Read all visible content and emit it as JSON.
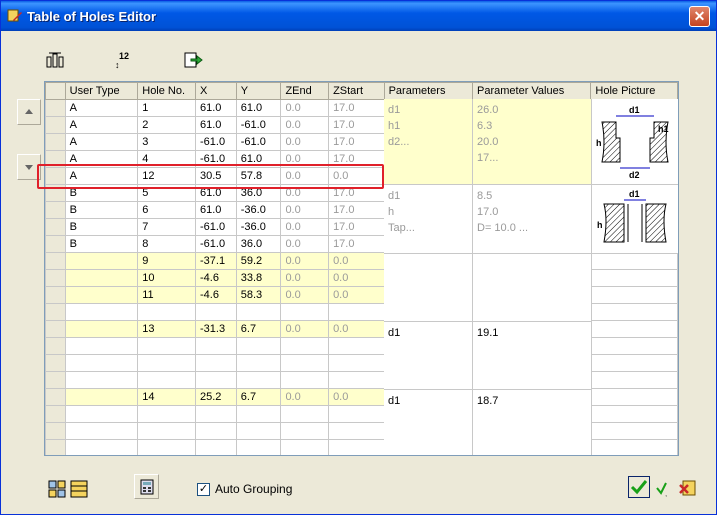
{
  "window": {
    "title": "Table of Holes Editor"
  },
  "toolbar": {
    "buttons": [
      "group-icon",
      "sort-numeric-icon",
      "export-icon"
    ]
  },
  "columns": [
    "User Type",
    "Hole No.",
    "X",
    "Y",
    "ZEnd",
    "ZStart",
    "Parameters",
    "Parameter Values",
    "Hole Picture"
  ],
  "rows": [
    {
      "type": "A",
      "no": "1",
      "x": "61.0",
      "y": "61.0",
      "zend": "0.0",
      "zstart": "17.0"
    },
    {
      "type": "A",
      "no": "2",
      "x": "61.0",
      "y": "-61.0",
      "zend": "0.0",
      "zstart": "17.0"
    },
    {
      "type": "A",
      "no": "3",
      "x": "-61.0",
      "y": "-61.0",
      "zend": "0.0",
      "zstart": "17.0"
    },
    {
      "type": "A",
      "no": "4",
      "x": "-61.0",
      "y": "61.0",
      "zend": "0.0",
      "zstart": "17.0"
    },
    {
      "type": "A",
      "no": "12",
      "x": "30.5",
      "y": "57.8",
      "zend": "0.0",
      "zstart": "0.0"
    },
    {
      "type": "B",
      "no": "5",
      "x": "61.0",
      "y": "36.0",
      "zend": "0.0",
      "zstart": "17.0"
    },
    {
      "type": "B",
      "no": "6",
      "x": "61.0",
      "y": "-36.0",
      "zend": "0.0",
      "zstart": "17.0"
    },
    {
      "type": "B",
      "no": "7",
      "x": "-61.0",
      "y": "-36.0",
      "zend": "0.0",
      "zstart": "17.0"
    },
    {
      "type": "B",
      "no": "8",
      "x": "-61.0",
      "y": "36.0",
      "zend": "0.0",
      "zstart": "17.0"
    },
    {
      "type": "",
      "no": "9",
      "x": "-37.1",
      "y": "59.2",
      "zend": "0.0",
      "zstart": "0.0"
    },
    {
      "type": "",
      "no": "10",
      "x": "-4.6",
      "y": "33.8",
      "zend": "0.0",
      "zstart": "0.0"
    },
    {
      "type": "",
      "no": "11",
      "x": "-4.6",
      "y": "58.3",
      "zend": "0.0",
      "zstart": "0.0"
    },
    {
      "type": "",
      "no": "",
      "x": "",
      "y": "",
      "zend": "",
      "zstart": ""
    },
    {
      "type": "",
      "no": "13",
      "x": "-31.3",
      "y": "6.7",
      "zend": "0.0",
      "zstart": "0.0"
    },
    {
      "type": "",
      "no": "",
      "x": "",
      "y": "",
      "zend": "",
      "zstart": ""
    },
    {
      "type": "",
      "no": "",
      "x": "",
      "y": "",
      "zend": "",
      "zstart": ""
    },
    {
      "type": "",
      "no": "",
      "x": "",
      "y": "",
      "zend": "",
      "zstart": ""
    },
    {
      "type": "",
      "no": "14",
      "x": "25.2",
      "y": "6.7",
      "zend": "0.0",
      "zstart": "0.0"
    },
    {
      "type": "",
      "no": "",
      "x": "",
      "y": "",
      "zend": "",
      "zstart": ""
    },
    {
      "type": "",
      "no": "",
      "x": "",
      "y": "",
      "zend": "",
      "zstart": ""
    },
    {
      "type": "",
      "no": "",
      "x": "",
      "y": "",
      "zend": "",
      "zstart": ""
    }
  ],
  "groups": {
    "a": {
      "params": "d1\nh1\nd2...",
      "values": "26.0\n6.3\n20.0\n17..."
    },
    "b": {
      "params": "d1\nh\nTap...",
      "values": "8.5\n17.0\nD= 10.0 ..."
    },
    "c": {
      "params": "d1",
      "values": "19.1"
    },
    "d": {
      "params": "d1",
      "values": "18.7"
    }
  },
  "pictures": {
    "a": {
      "d1": "d1",
      "h1": "h1",
      "h": "h",
      "d2": "d2"
    },
    "b": {
      "d1": "d1",
      "h": "h"
    }
  },
  "bottom": {
    "auto_grouping_label": "Auto Grouping",
    "auto_grouping_checked": true
  }
}
